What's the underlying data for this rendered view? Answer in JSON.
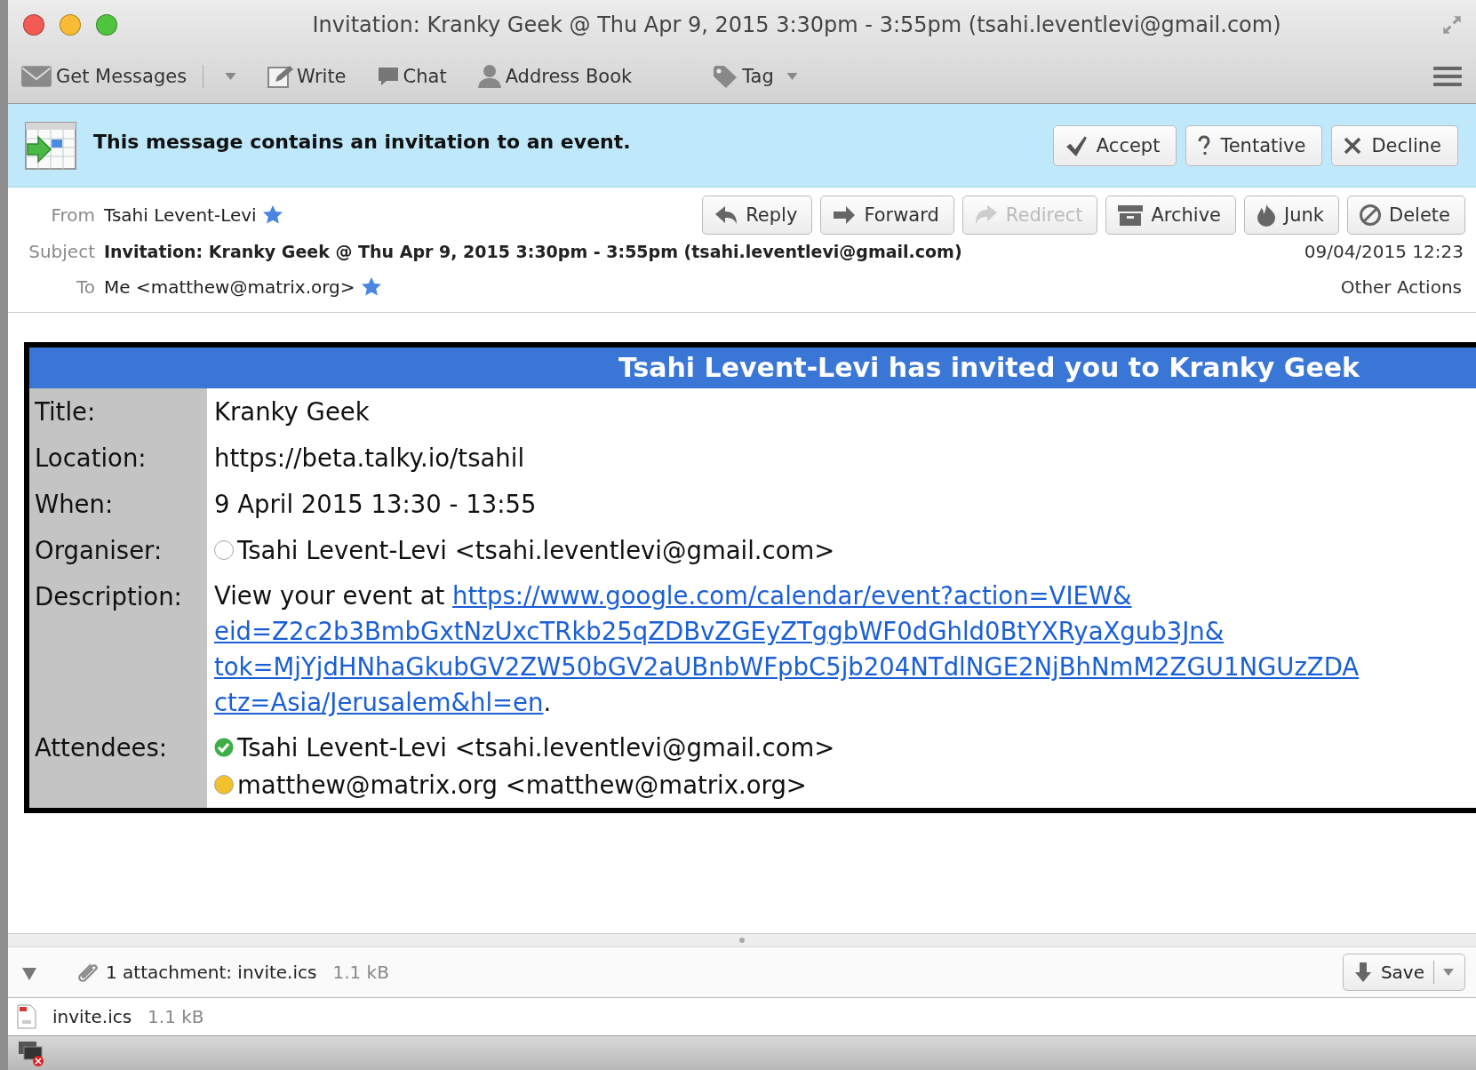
{
  "window": {
    "title": "Invitation: Kranky Geek @ Thu Apr 9, 2015 3:30pm - 3:55pm (tsahi.leventlevi@gmail.com)"
  },
  "toolbar": [
    {
      "label": "Get Messages",
      "has_menu": true
    },
    {
      "label": "Write",
      "has_menu": false
    },
    {
      "label": "Chat",
      "has_menu": false
    },
    {
      "label": "Address Book",
      "has_menu": false
    },
    {
      "label": "Tag",
      "has_menu": true
    }
  ],
  "invitation_bar": {
    "message": "This message contains an invitation to an event.",
    "buttons": [
      "Accept",
      "Tentative",
      "Decline"
    ]
  },
  "header": {
    "from_label": "From",
    "from": "Tsahi Levent-Levi",
    "subject_label": "Subject",
    "subject": "Invitation: Kranky Geek @ Thu Apr 9, 2015 3:30pm - 3:55pm (tsahi.leventlevi@gmail.com)",
    "to_label": "To",
    "to": "Me <matthew@matrix.org>",
    "date": "09/04/2015 12:23",
    "other_actions": "Other Actions",
    "actions": [
      {
        "label": "Reply",
        "disabled": false
      },
      {
        "label": "Forward",
        "disabled": false
      },
      {
        "label": "Redirect",
        "disabled": true
      },
      {
        "label": "Archive",
        "disabled": false
      },
      {
        "label": "Junk",
        "disabled": false
      },
      {
        "label": "Delete",
        "disabled": false
      }
    ]
  },
  "event": {
    "heading": "Tsahi Levent-Levi has invited you to Kranky Geek",
    "title_label": "Title:",
    "title": "Kranky Geek",
    "location_label": "Location:",
    "location": "https://beta.talky.io/tsahil",
    "when_label": "When:",
    "when": "9 April 2015 13:30 - 13:55",
    "organiser_label": "Organiser:",
    "organiser": {
      "name": "Tsahi Levent-Levi <tsahi.leventlevi@gmail.com>",
      "color": "#ffffff"
    },
    "description_label": "Description:",
    "description_prefix": "View your event at ",
    "description_link_lines": [
      "https://www.google.com/calendar/event?action=VIEW&",
      "eid=Z2c2b3BmbGxtNzUxcTRkb25qZDBvZGEyZTggbWF0dGhld0BtYXRyaXgub3Jn&",
      "tok=MjYjdHNhaGkubGV2ZW50bGV2aUBnbWFpbC5jb204NTdlNGE2NjBhNmM2ZGU1NGUzZDA",
      "ctz=Asia/Jerusalem&hl=en"
    ],
    "description_suffix": ".",
    "attendees_label": "Attendees:",
    "attendees": [
      {
        "name": "Tsahi Levent-Levi <tsahi.leventlevi@gmail.com>",
        "color": "#3fae49",
        "checked": true
      },
      {
        "name": "matthew@matrix.org <matthew@matrix.org>",
        "color": "#f2c12e",
        "checked": false
      }
    ]
  },
  "attachments": {
    "expanded": true,
    "summary": "1 attachment: invite.ics",
    "summary_size": "1.1 kB",
    "save": "Save",
    "files": [
      {
        "name": "invite.ics",
        "size": "1.1 kB"
      }
    ]
  }
}
